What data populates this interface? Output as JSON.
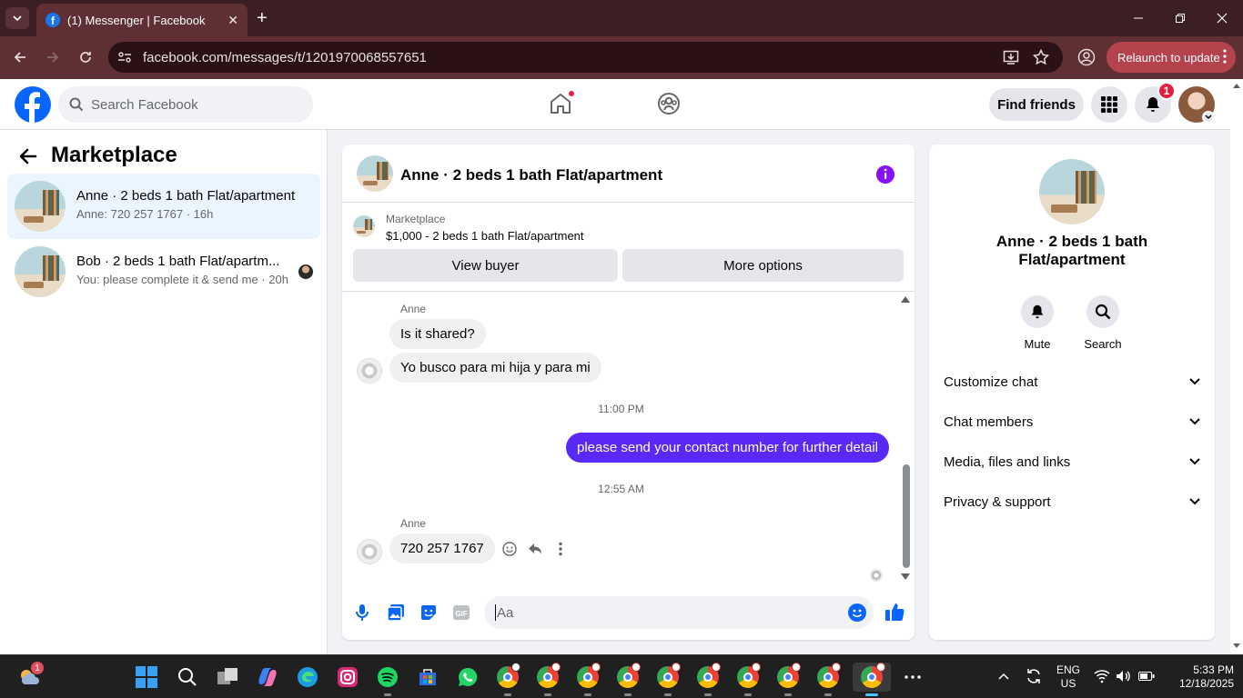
{
  "browser": {
    "tab_title": "(1) Messenger | Facebook",
    "url": "facebook.com/messages/t/1201970068557651",
    "relaunch_label": "Relaunch to update"
  },
  "fb_header": {
    "search_placeholder": "Search Facebook",
    "find_friends": "Find friends",
    "notification_count": "1"
  },
  "sidebar": {
    "title": "Marketplace",
    "conversations": [
      {
        "name": "Anne · 2 beds 1 bath Flat/apartment",
        "preview": "Anne: 720 257 1767 · 16h",
        "active": true
      },
      {
        "name": "Bob · 2 beds 1 bath Flat/apartm...",
        "preview": "You: please complete it & send me · 20h",
        "active": false
      }
    ]
  },
  "chat": {
    "title": "Anne · 2 beds 1 bath Flat/apartment",
    "marketplace_label": "Marketplace",
    "listing": "$1,000 - 2 beds 1 bath Flat/apartment",
    "view_buyer": "View buyer",
    "more_options": "More options",
    "messages": [
      {
        "sender": "Anne",
        "text": "Is it shared?",
        "direction": "in"
      },
      {
        "text": "Yo busco para mi hija y para mi",
        "direction": "in"
      },
      {
        "timestamp": "11:00 PM"
      },
      {
        "text": "please send your contact number for further detail",
        "direction": "out"
      },
      {
        "timestamp": "12:55 AM"
      },
      {
        "sender": "Anne",
        "text": "720 257 1767",
        "direction": "in"
      }
    ],
    "composer_placeholder": "Aa"
  },
  "info_panel": {
    "title_line1": "Anne · 2 beds 1 bath",
    "title_line2": "Flat/apartment",
    "mute": "Mute",
    "search": "Search",
    "sections": [
      "Customize chat",
      "Chat members",
      "Media, files and links",
      "Privacy & support"
    ]
  },
  "taskbar": {
    "weather_badge": "1",
    "lang_line1": "ENG",
    "lang_line2": "US",
    "time": "5:33 PM",
    "date": "12/18/2025"
  },
  "colors": {
    "fb_blue": "#0866ff",
    "outgoing_bubble": "#5b29f5",
    "accent_purple": "#8a0ff5",
    "chrome_frame": "#5e2f33"
  }
}
